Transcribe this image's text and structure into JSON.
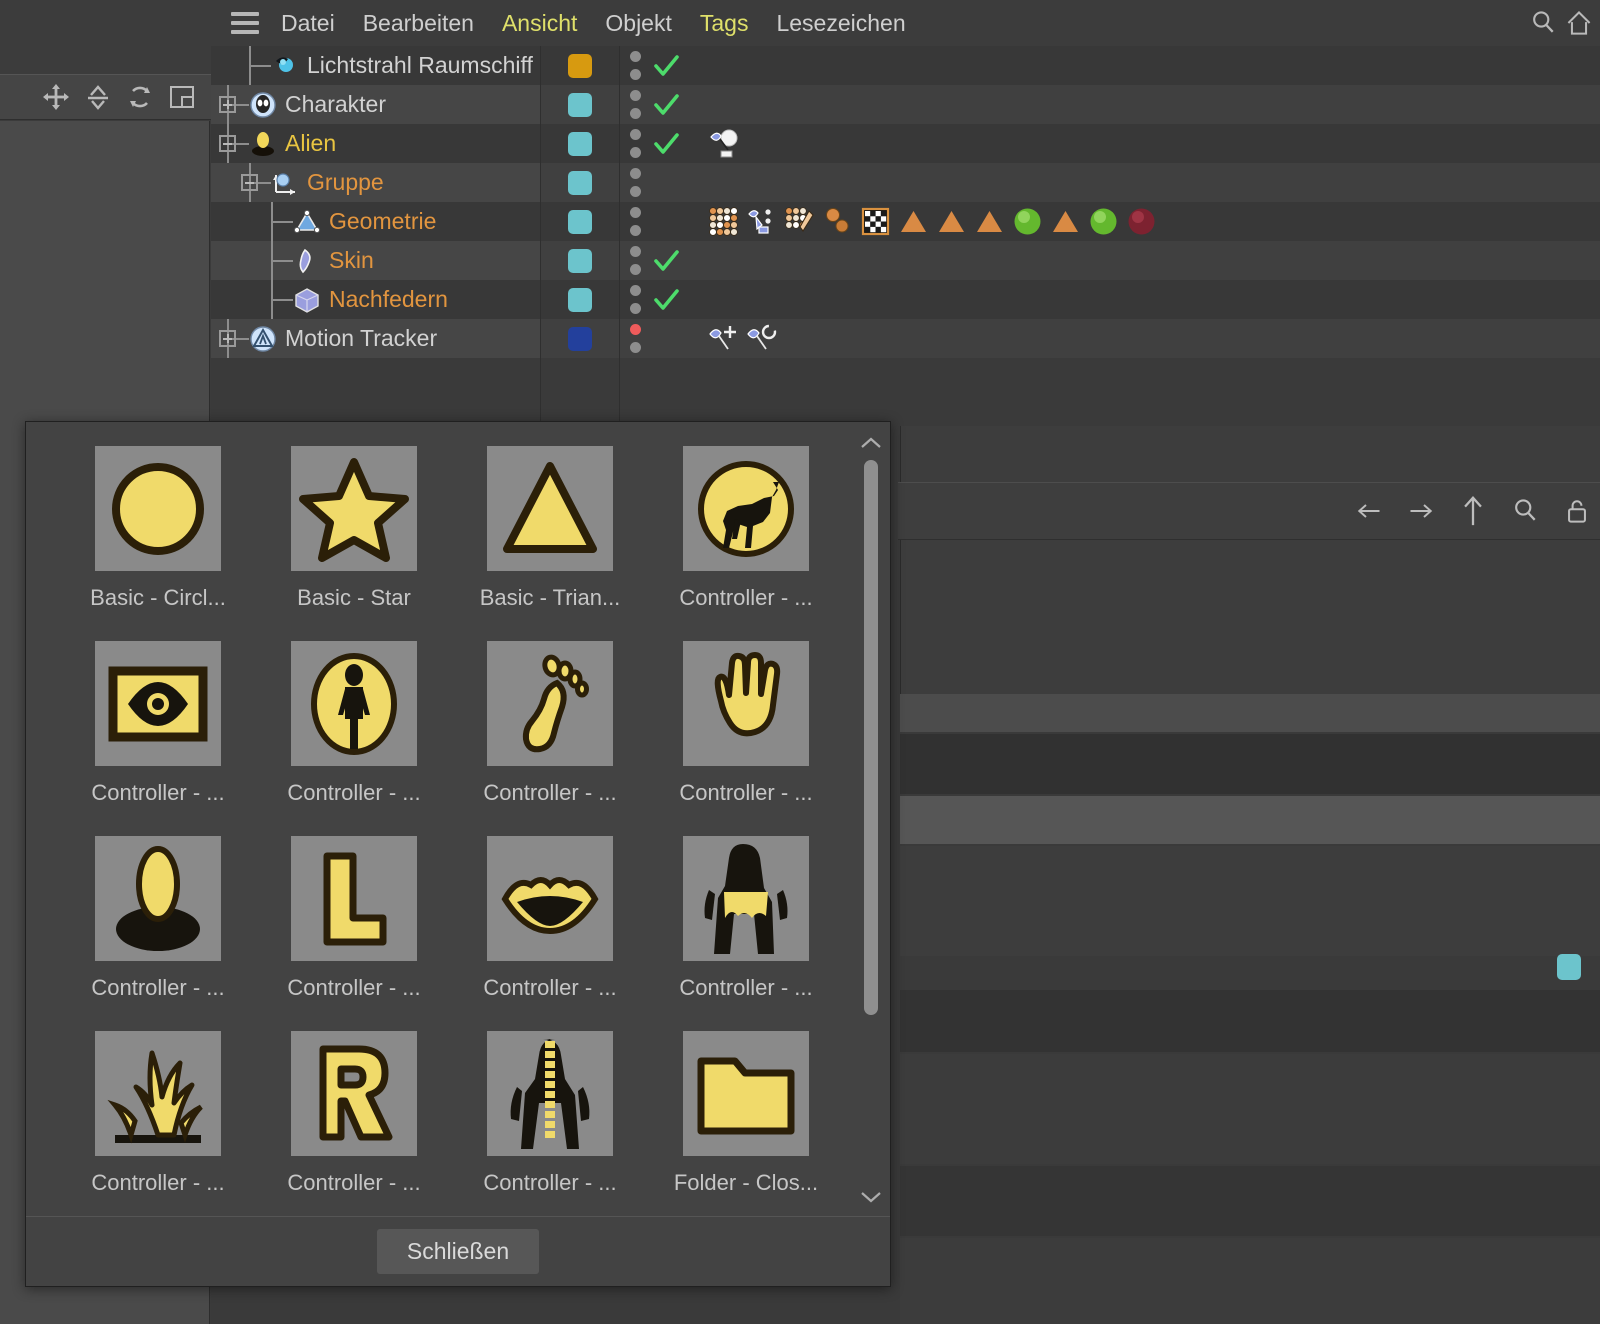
{
  "app": {
    "theme": {
      "bg": "#3a3a3a",
      "panel": "#434343",
      "row_odd": "#404040",
      "row_even": "#383838",
      "accent_yellow": "#dfe06a",
      "label_orange": "#e2953f",
      "swatch_teal": "#6cc4cc",
      "swatch_gold": "#d79a10",
      "swatch_blue": "#23409c",
      "check_green": "#4ddc6b",
      "dot_gray": "#8d8d8d",
      "dot_red": "#ef5b5b",
      "icon_yellow": "#f0da6a",
      "icon_outline": "#2b1f08",
      "tile_bg": "#8a8a8a"
    }
  },
  "toolbar": {
    "items": [
      {
        "name": "move-tool",
        "icon": "move-icon"
      },
      {
        "name": "scale-tool",
        "icon": "scale-icon"
      },
      {
        "name": "rotate-tool",
        "icon": "rotate-icon"
      },
      {
        "name": "layout-tool",
        "icon": "layout-icon"
      }
    ]
  },
  "menubar": {
    "hamburger": "menu-icon",
    "items": [
      {
        "label": "Datei",
        "highlight": false
      },
      {
        "label": "Bearbeiten",
        "highlight": false
      },
      {
        "label": "Ansicht",
        "highlight": true
      },
      {
        "label": "Objekt",
        "highlight": false
      },
      {
        "label": "Tags",
        "highlight": true
      },
      {
        "label": "Lesezeichen",
        "highlight": false
      }
    ],
    "right_icons": [
      {
        "name": "search-icon"
      },
      {
        "name": "home-icon"
      }
    ]
  },
  "object_manager": {
    "rows": [
      {
        "label": "Lichtstrahl Raumschiff",
        "label_color": "white",
        "icon": "light-object-icon",
        "depth": 1,
        "expander": "none",
        "swatch": "#d79a10",
        "dots": [
          "gray",
          "gray"
        ],
        "enabled_check": true,
        "tags": []
      },
      {
        "label": "Charakter",
        "label_color": "white",
        "icon": "alien-head-icon",
        "depth": 0,
        "expander": "plus",
        "swatch": "#6cc4cc",
        "dots": [
          "gray",
          "gray"
        ],
        "enabled_check": true,
        "tags": []
      },
      {
        "label": "Alien",
        "label_color": "yellow",
        "icon": "alien-figure-icon",
        "depth": 0,
        "expander": "minus",
        "swatch": "#6cc4cc",
        "dots": [
          "gray",
          "gray"
        ],
        "enabled_check": true,
        "tags": [
          "pin-sphere-tag"
        ]
      },
      {
        "label": "Gruppe",
        "label_color": "orange",
        "icon": "null-object-icon",
        "depth": 1,
        "expander": "minus",
        "swatch": "#6cc4cc",
        "dots": [
          "gray",
          "gray"
        ],
        "enabled_check": false,
        "tags": []
      },
      {
        "label": "Geometrie",
        "label_color": "orange",
        "icon": "polygon-object-icon",
        "depth": 2,
        "expander": "none",
        "swatch": "#6cc4cc",
        "dots": [
          "gray",
          "gray"
        ],
        "enabled_check": false,
        "tags": [
          "point-weight-tag",
          "pin-selection-tag",
          "weight-brush-tag",
          "two-spheres-tag",
          "checker-material-tag",
          "orange-triangle-tag",
          "orange-triangle-tag",
          "orange-triangle-tag",
          "green-sphere-material-tag",
          "orange-triangle-tag",
          "green-sphere-material-tag",
          "red-sphere-material-tag"
        ]
      },
      {
        "label": "Skin",
        "label_color": "orange",
        "icon": "skin-deformer-icon",
        "depth": 2,
        "expander": "none",
        "swatch": "#6cc4cc",
        "dots": [
          "gray",
          "gray"
        ],
        "enabled_check": true,
        "tags": []
      },
      {
        "label": "Nachfedern",
        "label_color": "orange",
        "icon": "jiggle-deformer-icon",
        "depth": 2,
        "expander": "none",
        "swatch": "#6cc4cc",
        "dots": [
          "gray",
          "gray"
        ],
        "enabled_check": true,
        "tags": []
      },
      {
        "label": "Motion Tracker",
        "label_color": "white",
        "icon": "motion-tracker-icon",
        "depth": 0,
        "expander": "plus",
        "swatch": "#23409c",
        "dots": [
          "red",
          "gray"
        ],
        "enabled_check": false,
        "tags": [
          "pin-plus-tag",
          "pin-cycle-tag"
        ]
      }
    ]
  },
  "navigation": {
    "icons": [
      {
        "name": "arrow-left-icon"
      },
      {
        "name": "arrow-right-icon"
      },
      {
        "name": "arrow-up-icon"
      },
      {
        "name": "search-icon"
      },
      {
        "name": "lock-icon"
      }
    ]
  },
  "icon_picker_dialog": {
    "scrollbar": {
      "up": "chevron-up-icon",
      "down": "chevron-down-icon"
    },
    "close_button": "Schließen",
    "items": [
      {
        "label": "Basic - Circl...",
        "icon": "circle-icon"
      },
      {
        "label": "Basic - Star",
        "icon": "star-icon"
      },
      {
        "label": "Basic - Trian...",
        "icon": "triangle-icon"
      },
      {
        "label": "Controller - ...",
        "icon": "horse-icon"
      },
      {
        "label": "Controller - ...",
        "icon": "eye-icon"
      },
      {
        "label": "Controller - ...",
        "icon": "person-icon"
      },
      {
        "label": "Controller - ...",
        "icon": "foot-icon"
      },
      {
        "label": "Controller - ...",
        "icon": "hand-icon"
      },
      {
        "label": "Controller - ...",
        "icon": "head-bust-icon"
      },
      {
        "label": "Controller - ...",
        "icon": "letter-l-icon"
      },
      {
        "label": "Controller - ...",
        "icon": "mouth-icon"
      },
      {
        "label": "Controller - ...",
        "icon": "hip-icon"
      },
      {
        "label": "Controller - ...",
        "icon": "hair-icon"
      },
      {
        "label": "Controller - ...",
        "icon": "letter-r-icon"
      },
      {
        "label": "Controller - ...",
        "icon": "spine-icon"
      },
      {
        "label": "Folder - Clos...",
        "icon": "folder-icon"
      }
    ]
  }
}
